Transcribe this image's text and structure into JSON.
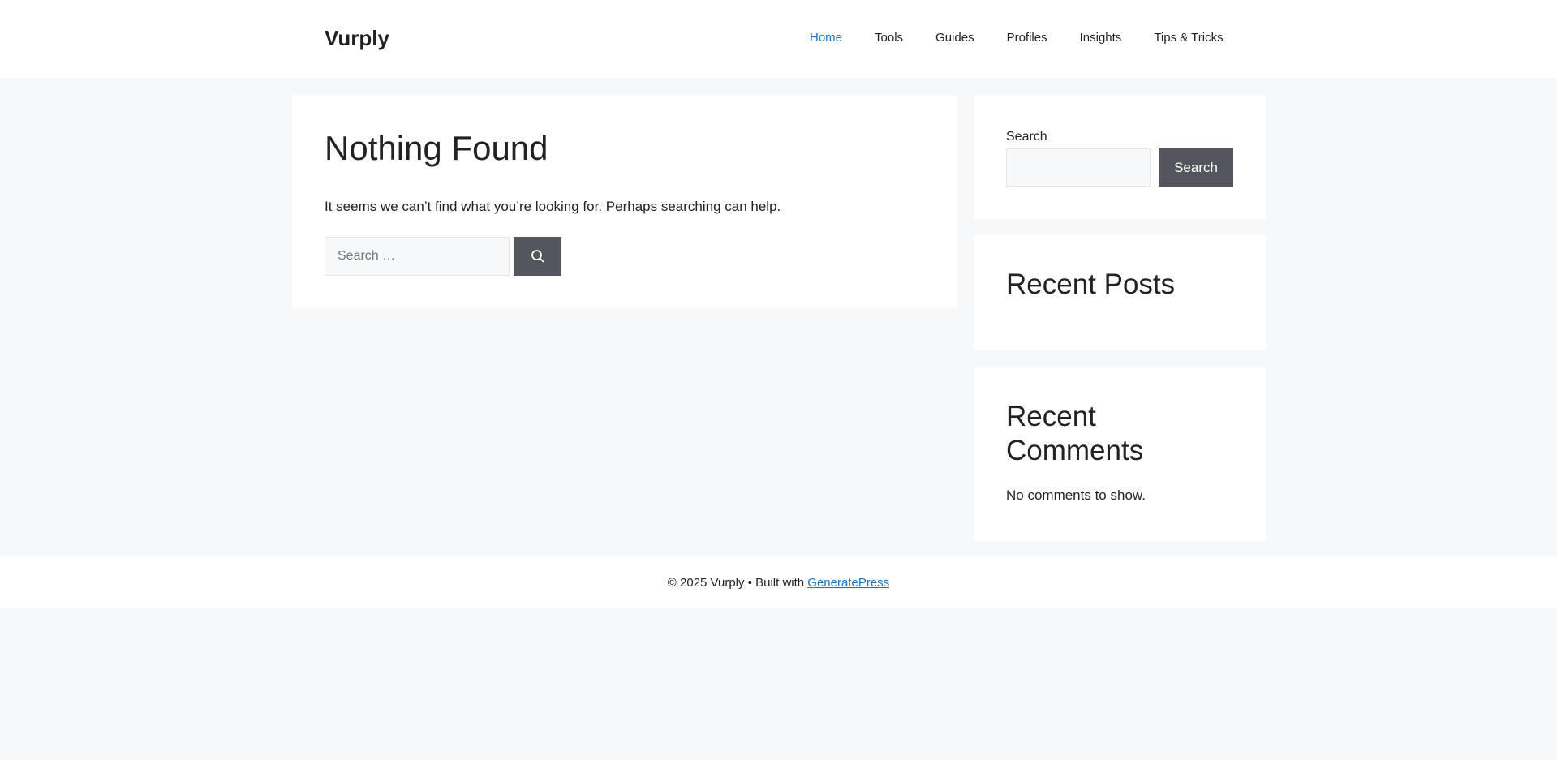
{
  "site": {
    "title": "Vurply"
  },
  "nav": {
    "items": [
      {
        "label": "Home",
        "active": true
      },
      {
        "label": "Tools"
      },
      {
        "label": "Guides"
      },
      {
        "label": "Profiles"
      },
      {
        "label": "Insights"
      },
      {
        "label": "Tips & Tricks"
      }
    ]
  },
  "main": {
    "title": "Nothing Found",
    "message": "It seems we can’t find what you’re looking for. Perhaps searching can help.",
    "search_placeholder": "Search …",
    "search_icon": "magnifier-icon"
  },
  "sidebar": {
    "search": {
      "label": "Search",
      "input_value": "",
      "button": "Search"
    },
    "recent_posts": {
      "title": "Recent Posts"
    },
    "recent_comments": {
      "title": "Recent Comments",
      "empty": "No comments to show."
    }
  },
  "footer": {
    "copyright": "© 2025 Vurply • Built with ",
    "link": "GeneratePress"
  },
  "colors": {
    "accent": "#1e73be",
    "button": "#55555e",
    "background": "#f7f8f9"
  }
}
